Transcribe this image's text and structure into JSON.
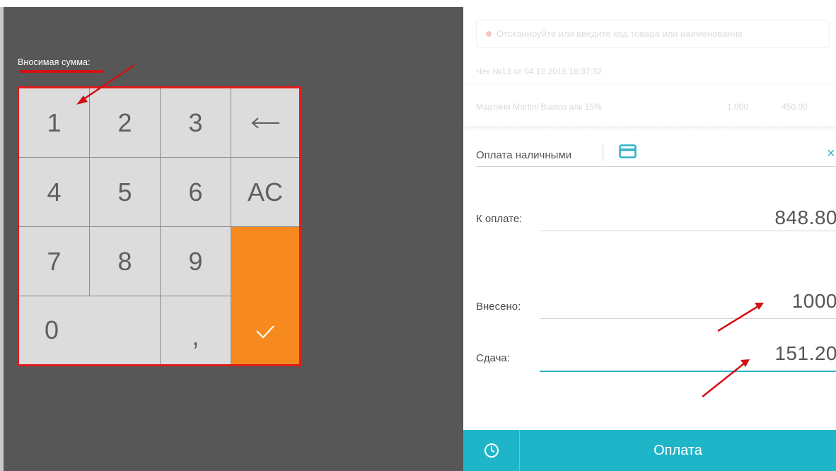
{
  "keypad_panel": {
    "label": "Вносимая сумма:",
    "keys": {
      "k1": "1",
      "k2": "2",
      "k3": "3",
      "backspace": "←",
      "k4": "4",
      "k5": "5",
      "k6": "6",
      "clear": "AC",
      "k7": "7",
      "k8": "8",
      "k9": "9",
      "k0": "0",
      "comma": ","
    }
  },
  "receipt": {
    "alert": "Отсканируйте или введите код товара или наименование",
    "title": "Чек №13 от 04.12.2015 16:37:32",
    "item": {
      "name": "Мартини Martini Bianco алк 15%",
      "qty": "1.000",
      "price": "450.00"
    }
  },
  "payment": {
    "method_label": "Оплата наличными",
    "due_label": "К оплате:",
    "due_value": "848.80",
    "paid_label": "Внесено:",
    "paid_value": "1000",
    "change_label": "Сдача:",
    "change_value": "151.20",
    "pay_button": "Оплата"
  },
  "colors": {
    "accent": "#1fb5c8",
    "confirm_key": "#f68a1e",
    "annotation": "#d31016",
    "background_dark": "#575757"
  },
  "icons": [
    "backspace-arrow-icon",
    "check-icon",
    "card-icon",
    "close-icon",
    "clock-icon",
    "annotation-arrow-icon"
  ]
}
